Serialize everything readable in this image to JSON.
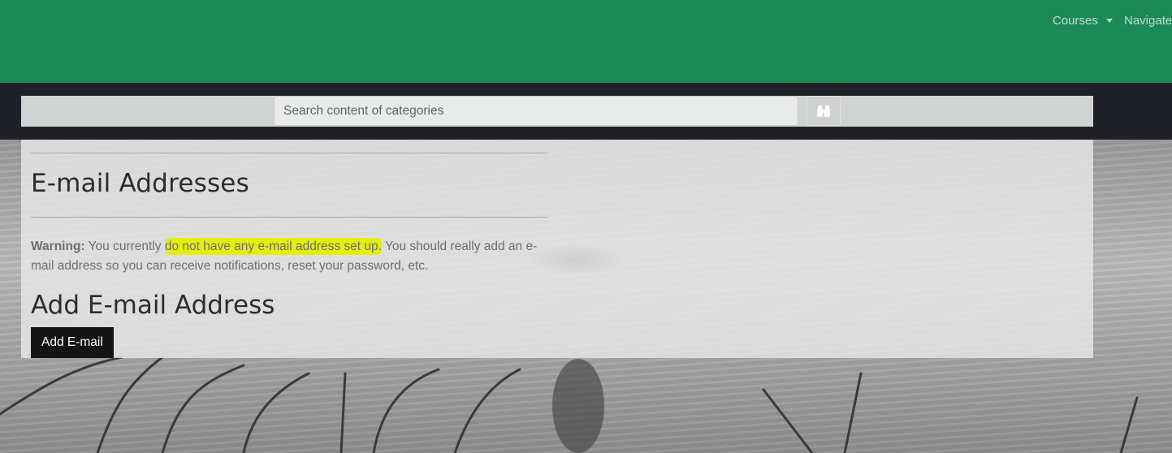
{
  "nav": {
    "courses_label": "Courses",
    "navigate_label": "Navigate"
  },
  "search": {
    "placeholder": "Search content of categories",
    "button_icon": "binoculars-icon"
  },
  "main": {
    "title": "E-mail Addresses",
    "warning_label": "Warning:",
    "warning_pre": " You currently ",
    "warning_highlight": "do not have any e-mail address set up.",
    "warning_post": " You should really add an e-mail address so you can receive notifications, reset your password, etc.",
    "add_heading": "Add E-mail Address",
    "add_button_label": "Add E-mail"
  },
  "colors": {
    "navbar": "#1b8a57",
    "dark_band": "#1f2126",
    "highlight": "#e4ee0c",
    "button": "#141414"
  }
}
